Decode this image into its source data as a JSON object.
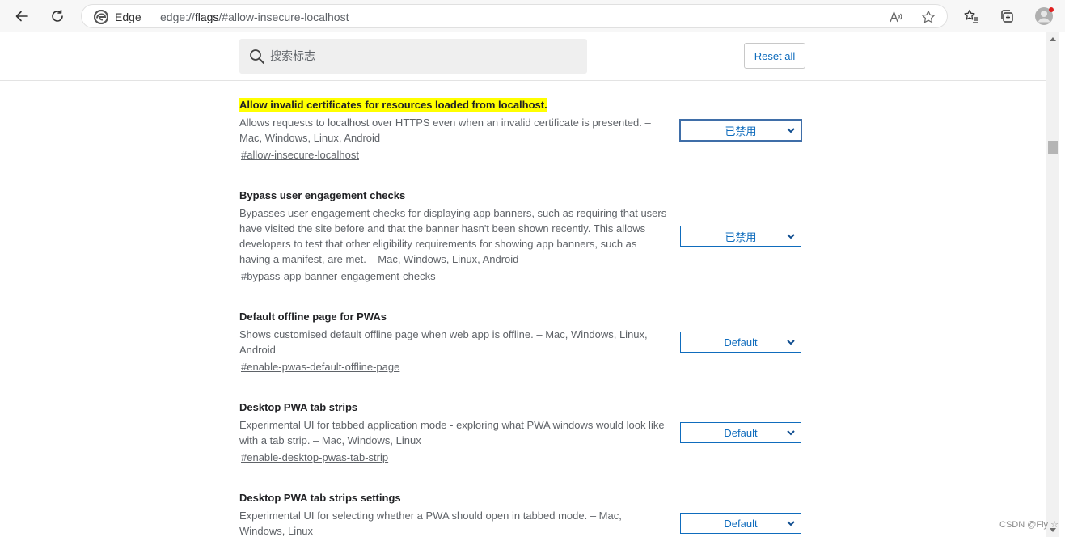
{
  "browser": {
    "brand_label": "Edge",
    "url_prefix": "edge://",
    "url_host": "flags",
    "url_path": "/#allow-insecure-localhost"
  },
  "header": {
    "search_placeholder": "搜索标志",
    "reset_label": "Reset all"
  },
  "flags": [
    {
      "title": "Allow invalid certificates for resources loaded from localhost.",
      "description": "Allows requests to localhost over HTTPS even when an invalid certificate is presented. – Mac, Windows, Linux, Android",
      "link": "#allow-insecure-localhost",
      "value": "已禁用"
    },
    {
      "title": "Bypass user engagement checks",
      "description": "Bypasses user engagement checks for displaying app banners, such as requiring that users have visited the site before and that the banner hasn't been shown recently. This allows developers to test that other eligibility requirements for showing app banners, such as having a manifest, are met. – Mac, Windows, Linux, Android",
      "link": "#bypass-app-banner-engagement-checks",
      "value": "已禁用"
    },
    {
      "title": "Default offline page for PWAs",
      "description": "Shows customised default offline page when web app is offline. – Mac, Windows, Linux, Android",
      "link": "#enable-pwas-default-offline-page",
      "value": "Default"
    },
    {
      "title": "Desktop PWA tab strips",
      "description": "Experimental UI for tabbed application mode - exploring what PWA windows would look like with a tab strip. – Mac, Windows, Linux",
      "link": "#enable-desktop-pwas-tab-strip",
      "value": "Default"
    },
    {
      "title": "Desktop PWA tab strips settings",
      "description": "Experimental UI for selecting whether a PWA should open in tabbed mode. – Mac, Windows, Linux",
      "link": "",
      "value": "Default"
    }
  ],
  "watermark": "CSDN @Fly ☆",
  "colors": {
    "accent": "#0f6cbd",
    "highlight": "#ffff00",
    "toolbar_bg": "#f7f7f7",
    "search_bg": "#efefef"
  }
}
